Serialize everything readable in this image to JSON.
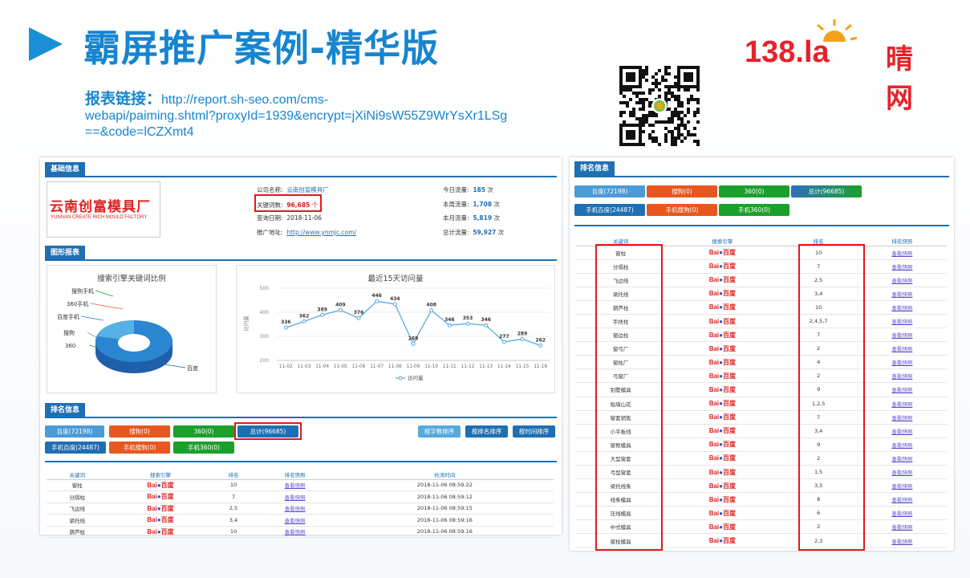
{
  "slide": {
    "title": "霸屏推广案例-精华版",
    "logo_num": "138.la",
    "logo_cn": "晴网",
    "report_label": "报表链接：",
    "report_url_1": "http://report.sh-seo.com/cms-",
    "report_url_2": "webapi/paiming.shtml?proxyId=1939&encrypt=jXiNi9sW55Z9WrYsXr1LSg",
    "report_url_3": "==&code=lCZXmt4"
  },
  "left": {
    "basic_header": "基础信息",
    "company_cn": "云南创富模具厂",
    "company_en": "YUNNAN CREATE RICH MOULD FACTORY",
    "company_label": "公司名称:",
    "company_value": "云南创富模具厂",
    "kw_label": "关键词数:",
    "kw_value": "96,685",
    "kw_unit": "个",
    "date_label": "查询日期:",
    "date_value": "2018-11-06",
    "site_label": "推广地址:",
    "site_value": "http://www.ynmjc.com/",
    "today_label": "今日流量:",
    "today_value": "185",
    "week_label": "本周流量:",
    "week_value": "1,708",
    "month_label": "本月流量:",
    "month_value": "5,819",
    "total_label": "总计流量:",
    "total_value": "59,927",
    "unit_ci": "次",
    "chart_header": "图形报表",
    "ranking_header": "排名信息",
    "buttons_row1": [
      "百度(72198)",
      "搜狗(0)",
      "360(0)",
      "总计(96685)"
    ],
    "buttons_row2": [
      "手机百度(24487)",
      "手机搜狗(0)",
      "手机360(0)"
    ],
    "sort_buttons": [
      "按字数排序",
      "按排名排序",
      "按时间排序"
    ],
    "table_headers": [
      "关键词",
      "搜索引擎",
      "排名",
      "排名快照",
      "检测时间"
    ],
    "table_rows": [
      {
        "kw": "窗柱",
        "rank": "10",
        "snap": "查看快照",
        "time": "2018-11-06 08:59:22"
      },
      {
        "kw": "分隔柱",
        "rank": "7",
        "snap": "查看快照",
        "time": "2018-11-06 08:59:12"
      },
      {
        "kw": "飞边线",
        "rank": "2,5",
        "snap": "查看快照",
        "time": "2018-11-06 08:59:15"
      },
      {
        "kw": "梁托线",
        "rank": "3,4",
        "snap": "查看快照",
        "time": "2018-11-06 08:59:16"
      },
      {
        "kw": "葫芦柱",
        "rank": "10",
        "snap": "查看快照",
        "time": "2018-11-06 08:59:16"
      }
    ]
  },
  "right": {
    "ranking_header": "排名信息",
    "buttons_row1": [
      "百度(72198)",
      "搜狗(0)",
      "360(0)",
      "总计(96685)"
    ],
    "buttons_row2": [
      "手机百度(24487)",
      "手机搜狗(0)",
      "手机360(0)"
    ],
    "table_headers": [
      "关键词",
      "搜索引擎",
      "排名",
      "排名快照"
    ],
    "table_rows": [
      {
        "kw": "窗柱",
        "rank": "10",
        "snap": "查看快照"
      },
      {
        "kw": "分隔柱",
        "rank": "7",
        "snap": "查看快照"
      },
      {
        "kw": "飞边线",
        "rank": "2,5",
        "snap": "查看快照"
      },
      {
        "kw": "梁托线",
        "rank": "3,4",
        "snap": "查看快照"
      },
      {
        "kw": "葫芦柱",
        "rank": "10",
        "snap": "查看快照"
      },
      {
        "kw": "手扶柱",
        "rank": "2,4,5,7",
        "snap": "查看快照"
      },
      {
        "kw": "窗边柱",
        "rank": "7",
        "snap": "查看快照"
      },
      {
        "kw": "窗弓厂",
        "rank": "2",
        "snap": "查看快照"
      },
      {
        "kw": "窗柱厂",
        "rank": "4",
        "snap": "查看快照"
      },
      {
        "kw": "弓窗厂",
        "rank": "2",
        "snap": "查看快照"
      },
      {
        "kw": "别墅模具",
        "rank": "9",
        "snap": "查看快照"
      },
      {
        "kw": "贴墙山花",
        "rank": "1,2,5",
        "snap": "查看快照"
      },
      {
        "kw": "窗套销售",
        "rank": "7",
        "snap": "查看快照"
      },
      {
        "kw": "小平板线",
        "rank": "3,4",
        "snap": "查看快照"
      },
      {
        "kw": "窗框模具",
        "rank": "9",
        "snap": "查看快照"
      },
      {
        "kw": "大型窗套",
        "rank": "2",
        "snap": "查看快照"
      },
      {
        "kw": "弓型窗套",
        "rank": "1,5",
        "snap": "查看快照"
      },
      {
        "kw": "梁托线条",
        "rank": "3,5",
        "snap": "查看快照"
      },
      {
        "kw": "线条模具",
        "rank": "8",
        "snap": "查看快照"
      },
      {
        "kw": "压线模具",
        "rank": "6",
        "snap": "查看快照"
      },
      {
        "kw": "中式模具",
        "rank": "2",
        "snap": "查看快照"
      },
      {
        "kw": "窗柱模具",
        "rank": "2,3",
        "snap": "查看快照"
      }
    ]
  },
  "baidu_text": "Bai",
  "baidu_text2": "百度",
  "chart_data": [
    {
      "type": "pie",
      "title": "搜索引擎关键词比例",
      "categories": [
        "搜狗手机",
        "360手机",
        "百度手机",
        "搜狗",
        "360",
        "百度"
      ],
      "values": [
        0,
        0,
        24487,
        0,
        0,
        72198
      ]
    },
    {
      "type": "line",
      "title": "最近15天访问量",
      "ylabel": "访问量",
      "ylim": [
        200,
        500
      ],
      "yticks": [
        200,
        300,
        400,
        500
      ],
      "x": [
        "11-02",
        "11-03",
        "11-04",
        "11-05",
        "11-06",
        "11-07",
        "11-08",
        "11-09",
        "11-10",
        "11-11",
        "11-12",
        "11-13",
        "11-14",
        "11-15",
        "11-16"
      ],
      "series": [
        {
          "name": "访问量",
          "values": [
            336,
            362,
            389,
            409,
            376,
            446,
            434,
            269,
            408,
            346,
            353,
            346,
            277,
            289,
            262
          ]
        }
      ],
      "color": "#5aa9e0",
      "legend": "bottom"
    }
  ]
}
